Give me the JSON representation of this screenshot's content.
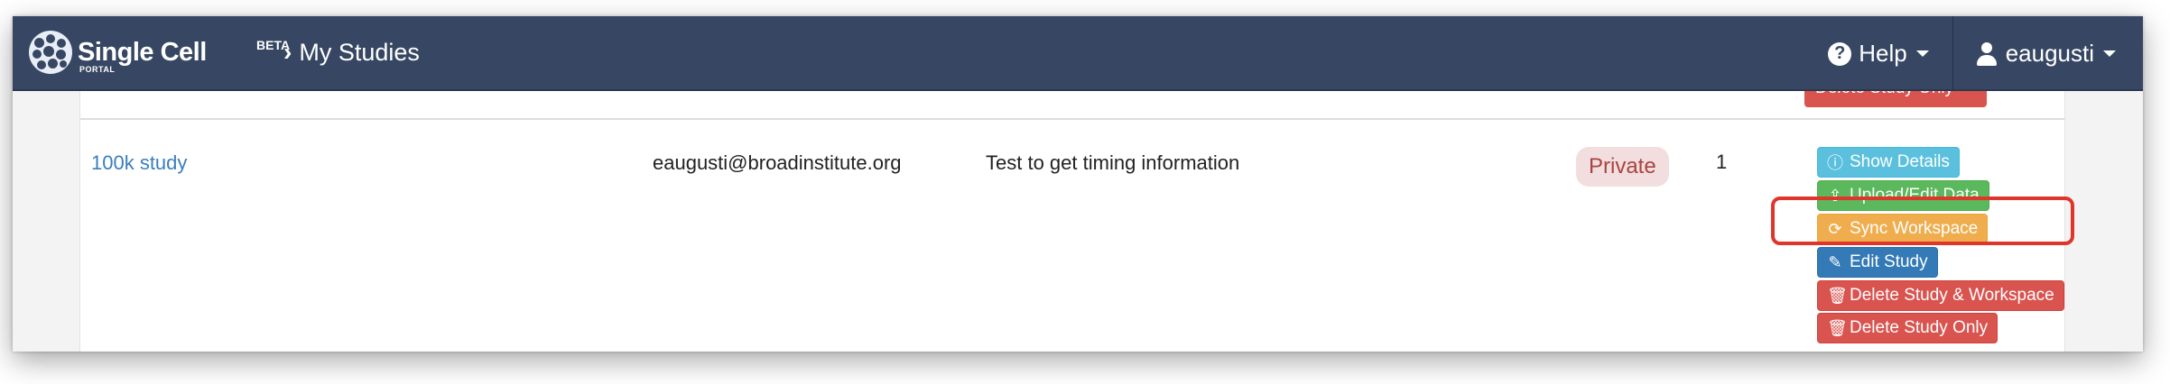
{
  "navbar": {
    "logo_title": "Single Cell",
    "logo_beta": "BETA",
    "logo_portal": "PORTAL",
    "breadcrumb": "My Studies",
    "help_label": "Help",
    "user_label": "eaugusti"
  },
  "prev_row": {
    "partial_button": "Delete Study Only"
  },
  "study_row": {
    "name": "100k study",
    "owner": "eaugusti@broadinstitute.org",
    "description": "Test to get timing information",
    "visibility": "Private",
    "shares": "1",
    "actions": {
      "show_details": "Show Details",
      "upload_edit_data": "Upload/Edit Data",
      "sync_workspace": "Sync Workspace",
      "edit_study": "Edit Study",
      "delete_study_workspace": "Delete Study & Workspace",
      "delete_study_only": "Delete Study Only"
    }
  },
  "colors": {
    "navbar": "#374763",
    "info": "#5bc0de",
    "success": "#5cb85c",
    "warning": "#f0ad4e",
    "primary": "#337ab7",
    "danger": "#d9534f",
    "highlight": "#e0352b"
  },
  "icons": {
    "help": "question-circle-icon",
    "user": "user-icon",
    "show_details": "info-circle-icon",
    "upload": "upload-icon",
    "sync": "refresh-icon",
    "edit": "edit-icon",
    "delete": "trash-icon"
  }
}
